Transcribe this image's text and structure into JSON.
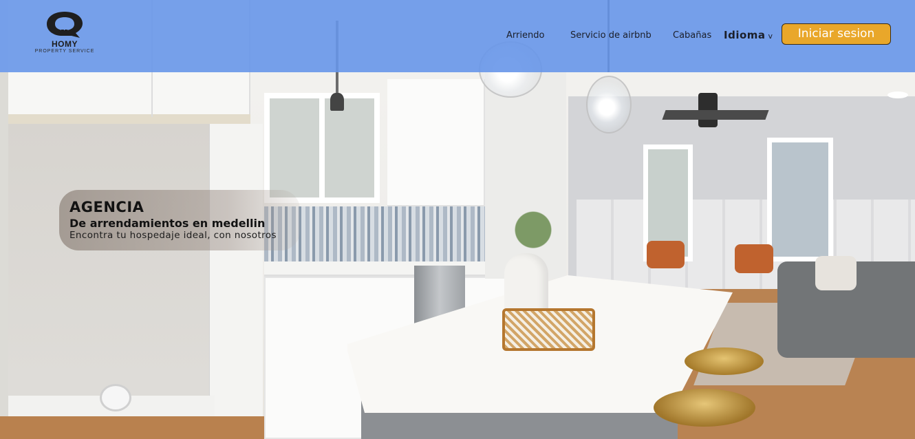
{
  "brand": {
    "name": "HOMY",
    "tagline": "PROPERTY SERVICE"
  },
  "nav": {
    "items": [
      {
        "label": "Arriendo"
      },
      {
        "label": "Servicio de airbnb"
      },
      {
        "label": "Cabañas"
      }
    ],
    "language_label": "Idioma",
    "language_caret": "v",
    "login_label": "Iniciar sesion"
  },
  "hero": {
    "title": "AGENCIA",
    "subtitle": "De arrendamientos en medellin",
    "tagline": "Encontra tu hospedaje ideal, con nosotros"
  },
  "colors": {
    "header_bg": "#6796e9",
    "login_button": "#e9a72a",
    "text_dark": "#1b1f2a"
  }
}
